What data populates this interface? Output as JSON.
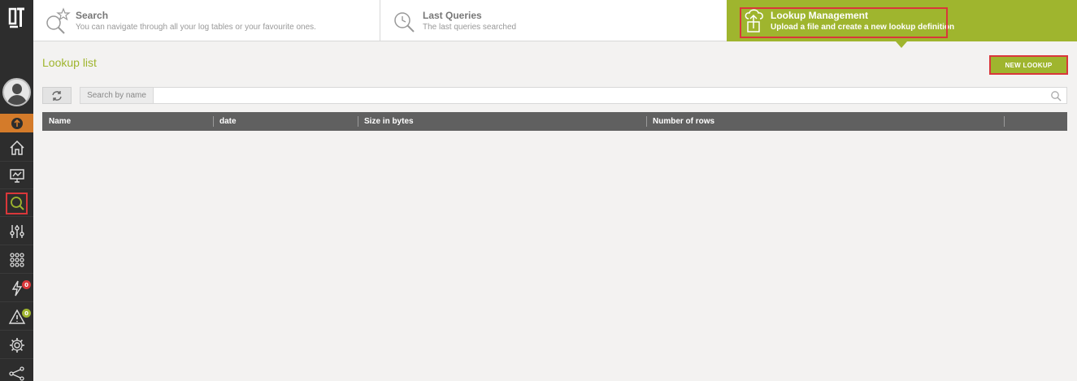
{
  "colors": {
    "accent": "#9fb52e",
    "sidebar": "#2d2d2d",
    "highlight": "#d9373a",
    "upload": "#d47b2a"
  },
  "sidebar": {
    "logo": "logo-icon",
    "items": [
      {
        "name": "home",
        "icon": "home-icon"
      },
      {
        "name": "dashboard",
        "icon": "monitor-icon"
      },
      {
        "name": "search",
        "icon": "search-icon",
        "active": true
      },
      {
        "name": "config",
        "icon": "sliders-icon"
      },
      {
        "name": "apps",
        "icon": "grid-icon"
      },
      {
        "name": "alerts",
        "icon": "bolt-icon",
        "badge": "0"
      },
      {
        "name": "warnings",
        "icon": "warning-icon",
        "badge": "0"
      },
      {
        "name": "settings",
        "icon": "gear-icon"
      },
      {
        "name": "share",
        "icon": "share-icon"
      }
    ]
  },
  "tabs": [
    {
      "title": "Search",
      "subtitle": "You can navigate through all your log tables or your favourite ones."
    },
    {
      "title": "Last Queries",
      "subtitle": "The last queries searched"
    },
    {
      "title": "Lookup Management",
      "subtitle": "Upload a file and create a new lookup definition"
    }
  ],
  "main": {
    "title": "Lookup list",
    "new_button": "NEW LOOKUP",
    "search": {
      "label": "Search by name",
      "placeholder": "",
      "value": ""
    },
    "table": {
      "columns": [
        "Name",
        "date",
        "Size in bytes",
        "Number of rows"
      ],
      "rows": []
    }
  }
}
